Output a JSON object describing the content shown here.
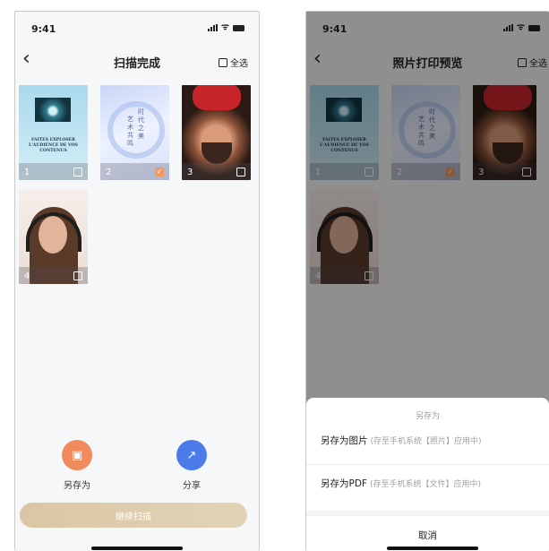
{
  "status": {
    "time": "9:41"
  },
  "scan_screen": {
    "title": "扫描完成",
    "select_all": "全选",
    "thumbnails": [
      {
        "num": "1",
        "checked": false,
        "caption": "FAITES EXPLOSER L'AUDIENCE DE VOS CONTENUS"
      },
      {
        "num": "2",
        "checked": true,
        "caption": [
          "时代之美",
          "艺术共鸣"
        ]
      },
      {
        "num": "3",
        "checked": false
      },
      {
        "num": "4",
        "checked": false
      }
    ],
    "actions": {
      "save_label": "另存为",
      "share_label": "分享"
    },
    "continue_label": "继续扫描"
  },
  "print_screen": {
    "title": "照片打印预览",
    "select_all": "全选",
    "thumb_nums": [
      "1",
      "2",
      "3",
      "4"
    ],
    "sheet": {
      "title": "另存为",
      "options": [
        {
          "label": "另存为图片",
          "hint": "(存至手机系统【照片】应用中)"
        },
        {
          "label": "另存为PDF",
          "hint": "(存至手机系统【文件】应用中)"
        }
      ],
      "cancel": "取消"
    }
  },
  "colors": {
    "save": "#f18a5d",
    "share": "#4a7be8",
    "accent": "#f29a5f",
    "continue": "#dccaa9"
  }
}
